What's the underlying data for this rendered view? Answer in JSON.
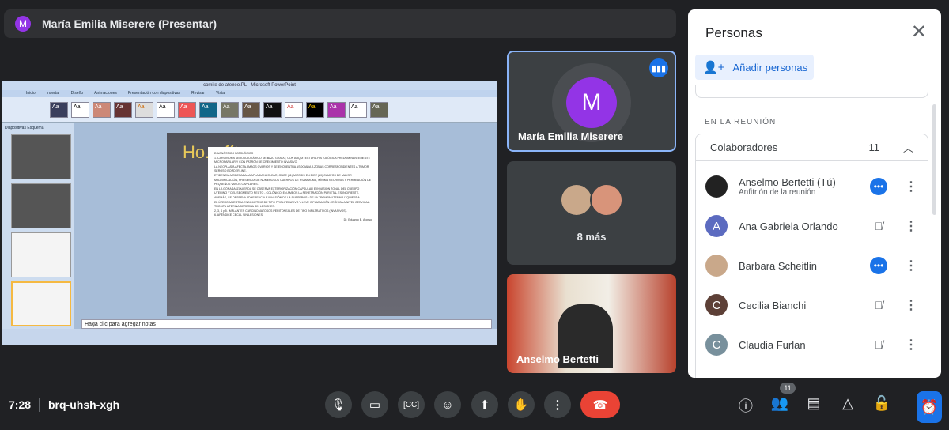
{
  "presenter": {
    "initial": "M",
    "label": "María Emilia Miserere (Presentar)"
  },
  "screen_share": {
    "window_title": "comite de ateneo.PL - Microsoft PowerPoint",
    "ribbon_tabs": [
      "Inicio",
      "Insertar",
      "Diseño",
      "Animaciones",
      "Presentación con diapositivas",
      "Revisar",
      "Vista"
    ],
    "panel_tabs": [
      "Diapositivas",
      "Esquema"
    ],
    "slide_title": "Ho... fít...",
    "document_lines": [
      "DIAGNÓSTICO PATOLÓGICO",
      "1. CARCINOMA SEROSO OVÁRICO DE BAJO GRADO, CON ARQUITECTURA HISTOLÓGICA PREDOMINANTEMENTE MICROPAPILAR Y CON PATRÓN DE CRECIMIENTO INVASIVO.",
      "LA NEOPLASIA AFECTA AMBOS OVARIOS Y SE ENCUENTRA ASOCIADA A ZONAS CORRESPONDIENTES A TUMOR SEROSO BORDERLINE.",
      "EVIDENCIA MODERADA ANAPLASIA NUCLEAR, ONCE (11) MITOSIS EN DIEZ (10) CAMPOS DE MAYOR MAGNIFICACIÓN, PRESENCIA DE NUMEROSOS CUERPOS DE PSAMMOMA, MÍNIMA NECROSIS Y PERMEACIÓN DE PEQUEÑOS VASOS CAPILARES.",
      "EN LA GÓNADA IZQUIERDA SE OBSERVA EXTERIORIZACIÓN CAPSULAR E INVASIÓN ZONAL DEL CUERPO UTERINO Y DEL SEGMENTO RECTO - COLÓNICO. EN AMBOS LA PENETRACIÓN PARIETAL ES INCIPIENTE.",
      "ADEMÁS, SE OBSERVA ADHERENCIA E INVASIÓN DE LA SUBSEROSA DE LA TROMPA UTERINA IZQUIERDA.",
      "EL ÚTERO MUESTRA ENDOMETRIO DE TIPO PROLIFERATIVO Y LEVE INFLAMACIÓN CRÓNICA A NIVEL CERVICAL.",
      "TROMPA UTERINA DERECHA SIN LESIONES.",
      "2, 3, 4 y 5. IMPLANTES CARCINOMATOSOS PERITONEALES DE TIPO INFILTRATIVOS (INVASIVOS).",
      "6. APÉNDICE CECAL SIN LESIONES.",
      "Dr. Eduardo E. Alonso"
    ],
    "notes_placeholder": "Haga clic para agregar notas"
  },
  "tiles": [
    {
      "initial": "M",
      "name": "María Emilia Miserere",
      "speaking": true
    },
    {
      "label": "8 más"
    },
    {
      "name": "Anselmo Bertetti"
    }
  ],
  "people_panel": {
    "title": "Personas",
    "add_button": "Añadir personas",
    "section_label": "EN LA REUNIÓN",
    "group_label": "Colaboradores",
    "group_count": "11",
    "participants": [
      {
        "name": "Anselmo Bertetti (Tú)",
        "subtitle": "Anfitrión de la reunión",
        "initial": "",
        "color": "#222222",
        "status": "speaking"
      },
      {
        "name": "Ana Gabriela Orlando",
        "initial": "A",
        "color": "#5c6bc0",
        "status": "muted"
      },
      {
        "name": "Barbara Scheitlin",
        "initial": "",
        "color": "#c9a88a",
        "status": "speaking"
      },
      {
        "name": "Cecilia Bianchi",
        "initial": "C",
        "color": "#5d4037",
        "status": "muted"
      },
      {
        "name": "Claudia Furlan",
        "initial": "C",
        "color": "#78909c",
        "status": "muted"
      }
    ]
  },
  "bottom_bar": {
    "time": "7:28",
    "meeting_code": "brq-uhsh-xgh",
    "people_badge": "11"
  },
  "colors": {
    "accent": "#1a73e8",
    "end_call": "#ea4335",
    "background": "#202124"
  }
}
